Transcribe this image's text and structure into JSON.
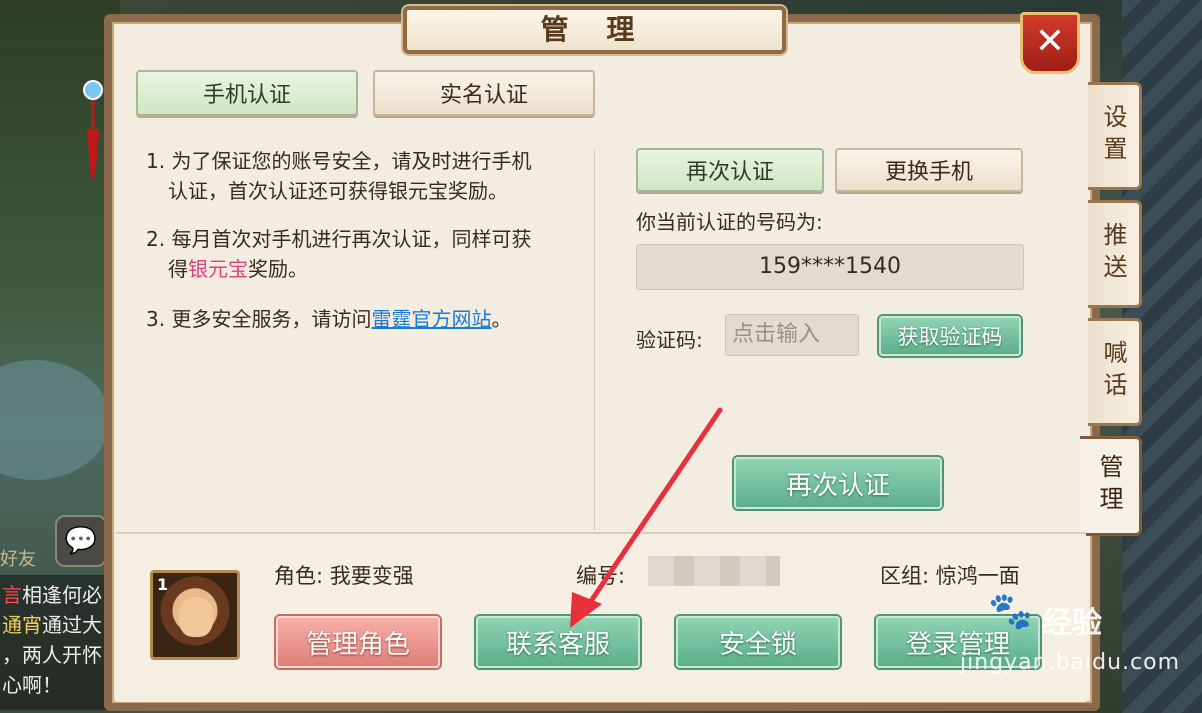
{
  "window": {
    "title": "管 理",
    "close_label": "✕"
  },
  "side_tabs": [
    {
      "label": "设置"
    },
    {
      "label": "推送"
    },
    {
      "label": "喊话"
    },
    {
      "label": "管理"
    }
  ],
  "top_tabs": {
    "phone": "手机认证",
    "realname": "实名认证"
  },
  "info": {
    "line1a": "1. 为了保证您的账号安全，请及时进行手机",
    "line1b": "认证，首次认证还可获得银元宝奖励。",
    "line2a": "2. 每月首次对手机进行再次认证，同样可获",
    "line2b_pre": "得",
    "line2b_pink": "银元宝",
    "line2b_post": "奖励。",
    "line3_pre": "3. 更多安全服务，请访问",
    "line3_link": "雷霆官方网站",
    "line3_post": "。"
  },
  "phone_panel": {
    "reverify_tab": "再次认证",
    "change_phone": "更换手机",
    "current_label": "你当前认证的号码为:",
    "phone_number": "159****1540",
    "code_label": "验证码:",
    "code_placeholder": "点击输入",
    "get_code": "获取验证码",
    "submit": "再次认证"
  },
  "footer": {
    "role": "角色: 我要变强",
    "id_label": "编号:",
    "server": "区组: 惊鸿一面",
    "level": "1",
    "buttons": {
      "manage_role": "管理角色",
      "contact_service": "联系客服",
      "security_lock": "安全锁",
      "login_manage": "登录管理"
    }
  },
  "background_chat": {
    "friend": "好友",
    "line1_tag": "言",
    "line1": "相逢何必",
    "line2_name": "通宵",
    "line2": "通过大",
    "line3": "，两人开怀",
    "line4": "心啊！"
  },
  "watermark": {
    "text": "经验",
    "url": "jingyan.baidu.com"
  },
  "colors": {
    "accent_green": "#5cae8c",
    "accent_pink": "#df7f78",
    "link": "#1c7ad8",
    "arrow": "#e8303a"
  }
}
